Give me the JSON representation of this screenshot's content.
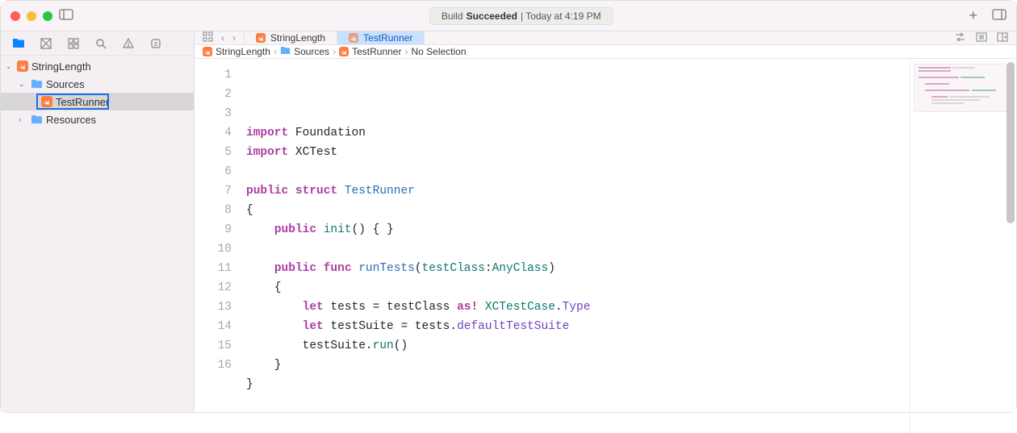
{
  "titlebar": {
    "status_prefix": "Build",
    "status_strong": "Succeeded",
    "status_suffix": "| Today at 4:19 PM"
  },
  "navigator": {
    "project": "StringLength",
    "folders": {
      "sources": "Sources",
      "resources": "Resources"
    },
    "file": "TestRunner"
  },
  "tabs": {
    "project": "StringLength",
    "file": "TestRunner"
  },
  "breadcrumb": {
    "c1": "StringLength",
    "c2": "Sources",
    "c3": "TestRunner",
    "c4": "No Selection"
  },
  "code": {
    "lines": [
      [
        {
          "t": "import ",
          "c": "kw-pink"
        },
        {
          "t": "Foundation",
          "c": "plain"
        }
      ],
      [
        {
          "t": "import ",
          "c": "kw-pink"
        },
        {
          "t": "XCTest",
          "c": "plain"
        }
      ],
      [],
      [
        {
          "t": "public struct ",
          "c": "kw-pink"
        },
        {
          "t": "TestRunner",
          "c": "typename"
        }
      ],
      [
        {
          "t": "{",
          "c": "plain"
        }
      ],
      [
        {
          "t": "    ",
          "c": ""
        },
        {
          "t": "public ",
          "c": "kw-pink"
        },
        {
          "t": "init",
          "c": "ident-teal"
        },
        {
          "t": "() { }",
          "c": "plain"
        }
      ],
      [],
      [
        {
          "t": "    ",
          "c": ""
        },
        {
          "t": "public func ",
          "c": "kw-pink"
        },
        {
          "t": "runTests",
          "c": "func-name"
        },
        {
          "t": "(",
          "c": "plain"
        },
        {
          "t": "testClass",
          "c": "ident-teal"
        },
        {
          "t": ":",
          "c": "plain"
        },
        {
          "t": "AnyClass",
          "c": "ident-teal"
        },
        {
          "t": ")",
          "c": "plain"
        }
      ],
      [
        {
          "t": "    {",
          "c": "plain"
        }
      ],
      [
        {
          "t": "        ",
          "c": ""
        },
        {
          "t": "let ",
          "c": "kw-pink"
        },
        {
          "t": "tests = testClass ",
          "c": "plain"
        },
        {
          "t": "as! ",
          "c": "kw-pink"
        },
        {
          "t": "XCTestCase",
          "c": "ident-teal"
        },
        {
          "t": ".",
          "c": "plain"
        },
        {
          "t": "Type",
          "c": "kw-purple"
        }
      ],
      [
        {
          "t": "        ",
          "c": ""
        },
        {
          "t": "let ",
          "c": "kw-pink"
        },
        {
          "t": "testSuite = tests.",
          "c": "plain"
        },
        {
          "t": "defaultTestSuite",
          "c": "kw-purple"
        }
      ],
      [
        {
          "t": "        testSuite.",
          "c": "plain"
        },
        {
          "t": "run",
          "c": "ident-teal"
        },
        {
          "t": "()",
          "c": "plain"
        }
      ],
      [
        {
          "t": "    }",
          "c": "plain"
        }
      ],
      [
        {
          "t": "}",
          "c": "plain"
        }
      ],
      [],
      []
    ]
  }
}
